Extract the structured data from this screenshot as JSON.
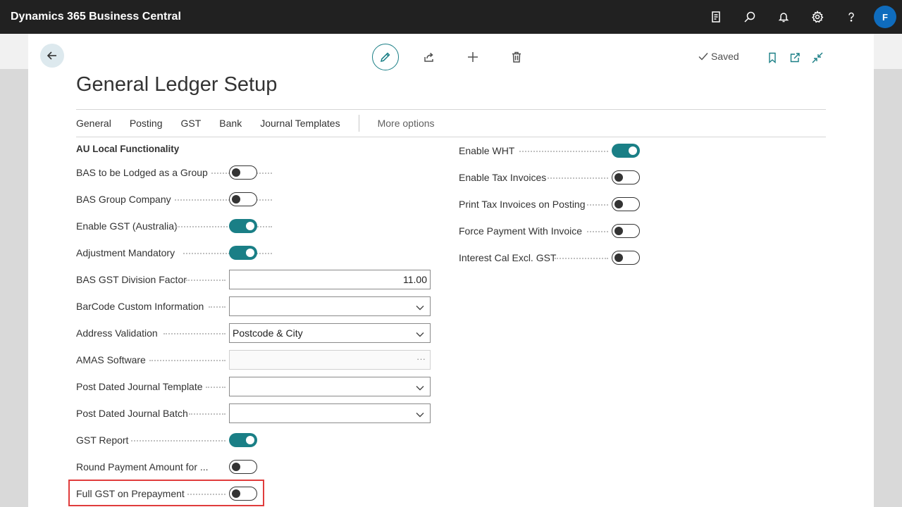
{
  "app": {
    "title": "Dynamics 365 Business Central",
    "avatar_initial": "F"
  },
  "appbar_icons": [
    "report-icon",
    "search-icon",
    "bell-icon",
    "gear-icon",
    "help-icon"
  ],
  "saved": {
    "label": "Saved"
  },
  "page": {
    "title": "General Ledger Setup"
  },
  "tabs": [
    {
      "label": "General"
    },
    {
      "label": "Posting"
    },
    {
      "label": "GST"
    },
    {
      "label": "Bank"
    },
    {
      "label": "Journal Templates"
    },
    {
      "label": "More options"
    }
  ],
  "section": {
    "title": "AU Local Functionality"
  },
  "left_fields": [
    {
      "label": "BAS to be Lodged as a Group",
      "type": "toggle",
      "value": false
    },
    {
      "label": "BAS Group Company",
      "type": "toggle",
      "value": false
    },
    {
      "label": "Enable GST (Australia)",
      "type": "toggle",
      "value": true
    },
    {
      "label": "Adjustment Mandatory",
      "type": "toggle",
      "value": true
    },
    {
      "label": "BAS GST Division Factor",
      "type": "number",
      "value": "11.00"
    },
    {
      "label": "BarCode Custom Information",
      "type": "dropdown",
      "value": ""
    },
    {
      "label": "Address Validation",
      "type": "dropdown",
      "value": "Postcode & City"
    },
    {
      "label": "AMAS Software",
      "type": "lookup",
      "value": ""
    },
    {
      "label": "Post Dated Journal Template",
      "type": "dropdown",
      "value": ""
    },
    {
      "label": "Post Dated Journal Batch",
      "type": "dropdown",
      "value": ""
    },
    {
      "label": "GST Report",
      "type": "toggle",
      "value": true
    },
    {
      "label": "Round Payment Amount for ...",
      "type": "toggle",
      "value": false
    },
    {
      "label": "Full GST on Prepayment",
      "type": "toggle",
      "value": false
    }
  ],
  "right_fields": [
    {
      "label": "Enable WHT",
      "type": "toggle",
      "value": true
    },
    {
      "label": "Enable Tax Invoices",
      "type": "toggle",
      "value": false
    },
    {
      "label": "Print Tax Invoices on Posting",
      "type": "toggle",
      "value": false
    },
    {
      "label": "Force Payment With Invoice",
      "type": "toggle",
      "value": false
    },
    {
      "label": "Interest Cal Excl. GST",
      "type": "toggle",
      "value": false
    }
  ],
  "colors": {
    "accent": "#1a7f86",
    "appbar": "#212121",
    "highlight": "#e03c3c",
    "avatar": "#0f6cbd"
  }
}
